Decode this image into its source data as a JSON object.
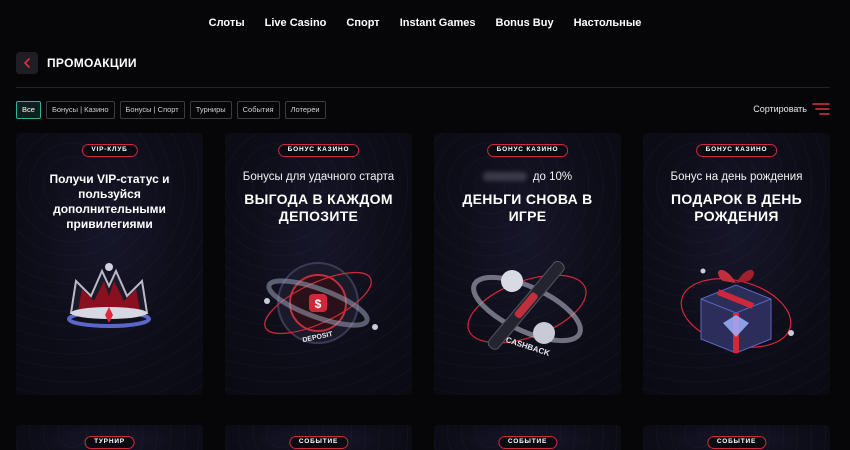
{
  "nav": {
    "items": [
      "Слоты",
      "Live Casino",
      "Спорт",
      "Instant Games",
      "Bonus Buy",
      "Настольные"
    ]
  },
  "header": {
    "title": "ПРОМОАКЦИИ"
  },
  "filters": [
    "Все",
    "Бонусы | Казино",
    "Бонусы | Спорт",
    "Турниры",
    "События",
    "Лотереи"
  ],
  "active_filter": "Все",
  "sort": {
    "label": "Сортировать"
  },
  "cards": [
    {
      "badge": "VIP-КЛУБ",
      "subtitle": "",
      "title": "Получи VIP-статус и пользуйся дополнительными привилегиями"
    },
    {
      "badge": "БОНУС КАЗИНО",
      "subtitle": "Бонусы для удачного старта",
      "title": "ВЫГОДА В КАЖДОМ ДЕПОЗИТЕ"
    },
    {
      "badge": "БОНУС КАЗИНО",
      "subtitle": "до 10%",
      "title": "ДЕНЬГИ СНОВА В ИГРЕ"
    },
    {
      "badge": "БОНУС КАЗИНО",
      "subtitle": "Бонус на день рождения",
      "title": "ПОДАРОК В ДЕНЬ РОЖДЕНИЯ"
    }
  ],
  "cards_row2": [
    {
      "badge": "ТУРНИР"
    },
    {
      "badge": "СОБЫТИЕ"
    },
    {
      "badge": "СОБЫТИЕ"
    },
    {
      "badge": "СОБЫТИЕ"
    }
  ],
  "art_text": {
    "deposit": "DEPOSIT",
    "cashback": "CASHBACK"
  },
  "colors": {
    "accent_red": "#d0283a",
    "active_filter": "#2fb0a0",
    "background": "#060608"
  },
  "icons": [
    "chevron-left-icon",
    "sort-icon"
  ]
}
